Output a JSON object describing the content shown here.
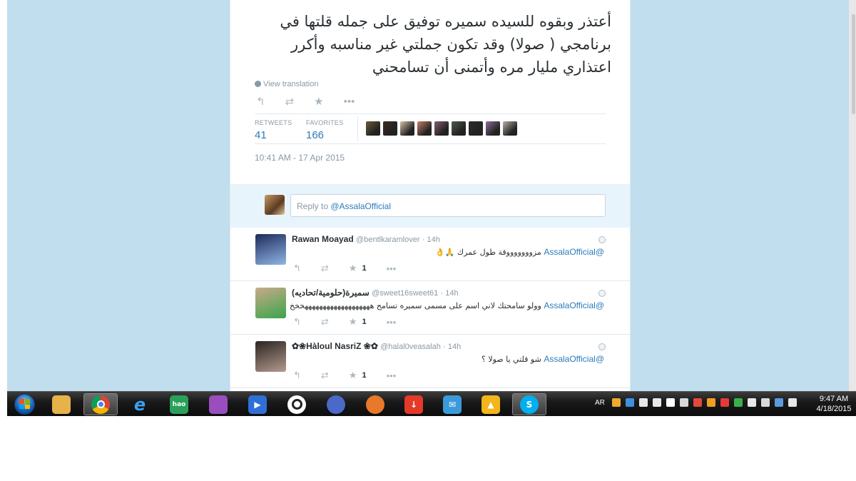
{
  "tweet": {
    "text": "أعتذر وبقوه للسيده سميره توفيق على جمله قلتها في برنامجي ( صولا) وقد تكون جملتي غير مناسبه وأكرر اعتذاري مليار مره وأتمنى أن تسامحني",
    "view_translation": "View translation",
    "stats": {
      "retweets_label": "RETWEETS",
      "retweets_value": "41",
      "favorites_label": "FAVORITES",
      "favorites_value": "166"
    },
    "timestamp": "10:41 AM - 17 Apr 2015",
    "actions": [
      "reply-icon",
      "retweet-icon",
      "favorite-icon",
      "more-icon"
    ],
    "favoriter_avatar_colors": [
      "#6b5a3a",
      "#3b2a22",
      "#d8c1a5",
      "#c9826a",
      "#8a5d73",
      "#4d5a48",
      "#2f2a2a",
      "#8b6f98",
      "#b7b0a6"
    ]
  },
  "reply_box": {
    "prefix": "Reply to ",
    "mention": "@AssalaOfficial"
  },
  "replies": [
    {
      "name": "Rawan Moayad",
      "handle": "@bentlkaramlover",
      "time": "· 14h",
      "mention": "@AssalaOfficial",
      "text": "مزوووووووقة طول عمرك 🙏👌",
      "favorites": "1",
      "avatar_colors": [
        "#1e2a5a",
        "#8fb6e6"
      ]
    },
    {
      "name": "سميرة(حلومية/تحاديه)",
      "handle": "@sweet16sweet61",
      "time": "· 14h",
      "mention": "@AssalaOfficial",
      "text": "وولو سامحتك لاني اسم على مسمى سميره تسامح هههههههههههههههههههخخخ",
      "favorites": "1",
      "avatar_colors": [
        "#c9a98a",
        "#3aa64a"
      ]
    },
    {
      "name": "✿❀Hàloul NasriZ ❀✿",
      "handle": "@halal0veasalah",
      "time": "· 14h",
      "mention": "@AssalaOfficial",
      "text": "شو قلتي يا صولا ؟",
      "favorites": "1",
      "avatar_colors": [
        "#2a2422",
        "#b49a8c"
      ]
    }
  ],
  "taskbar": {
    "apps": [
      {
        "name": "explorer-icon",
        "color": "#e7b24a",
        "glyph": ""
      },
      {
        "name": "chrome-icon",
        "color": "#db4437",
        "glyph": ""
      },
      {
        "name": "ie-icon",
        "color": "#1e7fd6",
        "glyph": "e"
      },
      {
        "name": "hao123-icon",
        "color": "#2aa05a",
        "glyph": "hao"
      },
      {
        "name": "messenger-icon",
        "color": "#9a4dbf",
        "glyph": ""
      },
      {
        "name": "media-player-icon",
        "color": "#2f6fd6",
        "glyph": "▶"
      },
      {
        "name": "circle-app-icon",
        "color": "#ffffff",
        "glyph": ""
      },
      {
        "name": "browser-sphere-icon",
        "color": "#4a69c9",
        "glyph": ""
      },
      {
        "name": "firefox-icon",
        "color": "#e8782a",
        "glyph": ""
      },
      {
        "name": "download-icon",
        "color": "#e33a2a",
        "glyph": "↓"
      },
      {
        "name": "mail-icon",
        "color": "#3b9ad9",
        "glyph": "✉"
      },
      {
        "name": "warning-app-icon",
        "color": "#f2b51c",
        "glyph": "▲"
      },
      {
        "name": "skype-icon",
        "color": "#00aff0",
        "glyph": "S"
      }
    ],
    "language": "AR",
    "tray_colors": [
      "#f0a830",
      "#3f8fe0",
      "#e8e8e8",
      "#e8e8e8",
      "#ffffff",
      "#d8d8d8",
      "#e04a3a",
      "#f0a020",
      "#e63a3a",
      "#3ab04a",
      "#e8e8e8",
      "#d9d9d9",
      "#5a9ae0",
      "#e8e8e8"
    ],
    "clock_time": "9:47 AM",
    "clock_date": "4/18/2015"
  },
  "colors": {
    "background": "#c0deed",
    "link": "#2b7bb9",
    "muted": "#8899a6"
  }
}
